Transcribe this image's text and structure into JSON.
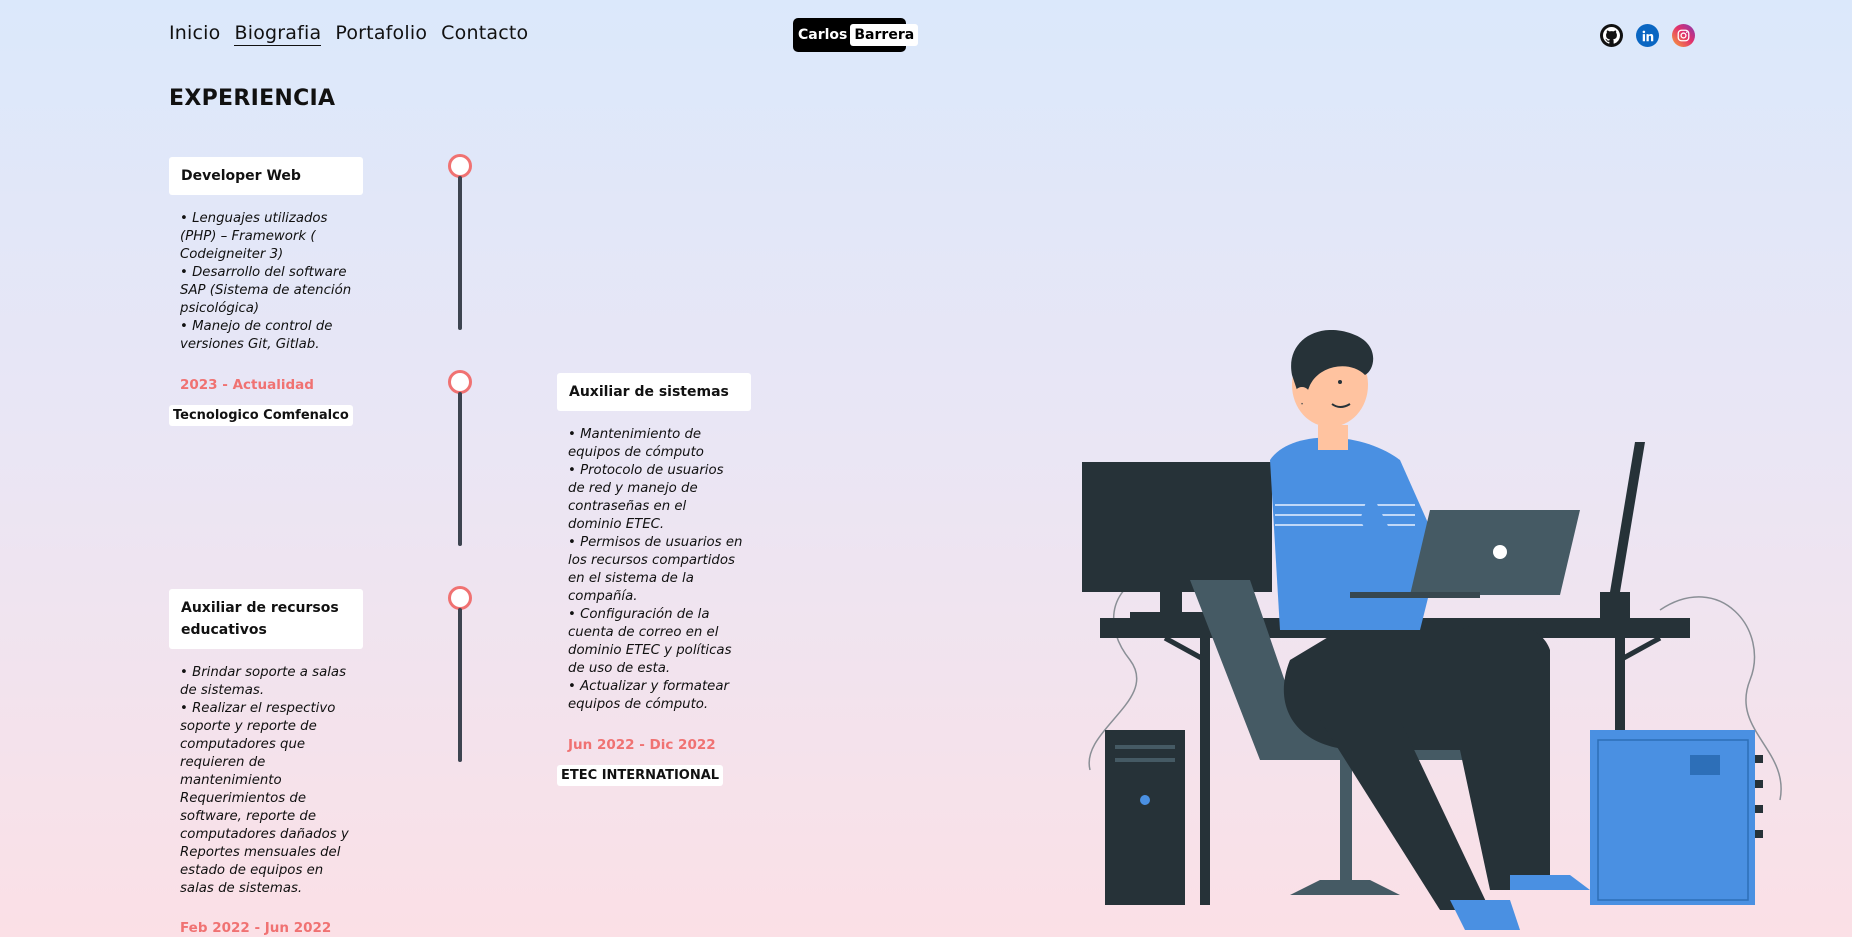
{
  "nav": {
    "items": [
      {
        "label": "Inicio",
        "active": false
      },
      {
        "label": "Biografia",
        "active": true
      },
      {
        "label": "Portafolio",
        "active": false
      },
      {
        "label": "Contacto",
        "active": false
      }
    ]
  },
  "logo": {
    "first": "Carlos",
    "last": "Barrera"
  },
  "socials": [
    {
      "icon": "github-icon"
    },
    {
      "icon": "linkedin-icon"
    },
    {
      "icon": "instagram-icon"
    }
  ],
  "section_title": "EXPERIENCIA",
  "experience": [
    {
      "title": "Developer Web",
      "description": [
        "• Lenguajes utilizados (PHP) – Framework ( Codeigneiter 3)",
        "• Desarrollo del software SAP (Sistema de atención psicológica)",
        "• Manejo de control de versiones Git, Gitlab."
      ],
      "date": "2023 - Actualidad",
      "company": "Tecnologico Comfenalco"
    },
    {
      "title": "Auxiliar de sistemas",
      "description": [
        "• Mantenimiento de equipos de cómputo",
        "• Protocolo de usuarios de red y manejo de contraseñas en el dominio ETEC.",
        "• Permisos de usuarios en los recursos compartidos en el sistema de la compañía.",
        "• Configuración de la cuenta de correo en el dominio ETEC y políticas de uso de esta.",
        "• Actualizar y formatear equipos de cómputo."
      ],
      "date": "Jun 2022 - Dic 2022",
      "company": "ETEC INTERNATIONAL"
    },
    {
      "title": "Auxiliar de recursos educativos",
      "description": [
        "• Brindar soporte a salas de sistemas.",
        "• Realizar el respectivo soporte y reporte de computadores que requieren de mantenimiento Requerimientos de software, reporte de computadores dañados y Reportes mensuales del estado de equipos en salas de sistemas."
      ],
      "date": "Feb 2022 - Jun 2022",
      "company": ""
    }
  ],
  "colors": {
    "accent": "#f07272",
    "timeline": "#3d4450",
    "shirt": "#4a90e2",
    "dark": "#263238"
  }
}
